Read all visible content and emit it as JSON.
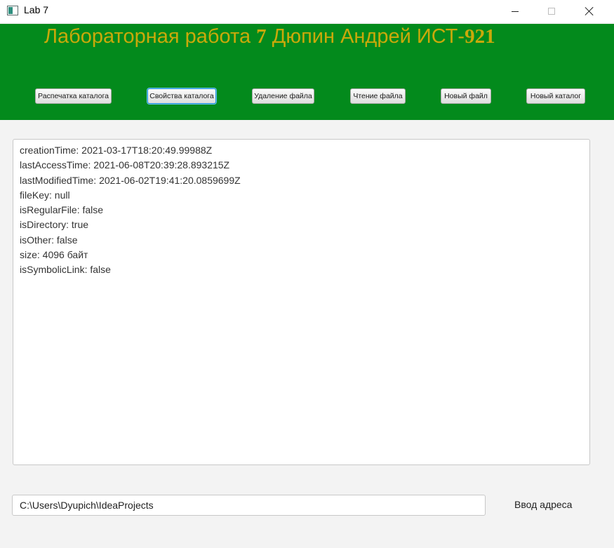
{
  "window": {
    "title": "Lab 7"
  },
  "header": {
    "title_part1": "Лабораторная работа ",
    "title_num": "7",
    "title_part2": " Дюпин Андрей ИСТ-",
    "title_group": "921",
    "background": "#038a1c",
    "text_color": "#c9a90a"
  },
  "toolbar": {
    "buttons": [
      {
        "label": "Распечатка каталога"
      },
      {
        "label": "Свойства каталога",
        "focused": true
      },
      {
        "label": "Удаление файла"
      },
      {
        "label": "Чтение файла"
      },
      {
        "label": "Новый файл"
      },
      {
        "label": "Новый каталог"
      }
    ]
  },
  "output": {
    "lines": [
      "creationTime: 2021-03-17T18:20:49.99988Z",
      "lastAccessTime: 2021-06-08T20:39:28.893215Z",
      "lastModifiedTime: 2021-06-02T19:41:20.0859699Z",
      "fileKey: null",
      "isRegularFile: false",
      "isDirectory: true",
      "isOther: false",
      "size: 4096 байт",
      "isSymbolicLink: false"
    ]
  },
  "address": {
    "value": "C:\\Users\\Dyupich\\IdeaProjects",
    "label": "Ввод адреса"
  },
  "icons": {
    "app": "window-app-icon",
    "minimize": "minimize-icon",
    "maximize": "maximize-icon",
    "close": "close-icon"
  }
}
